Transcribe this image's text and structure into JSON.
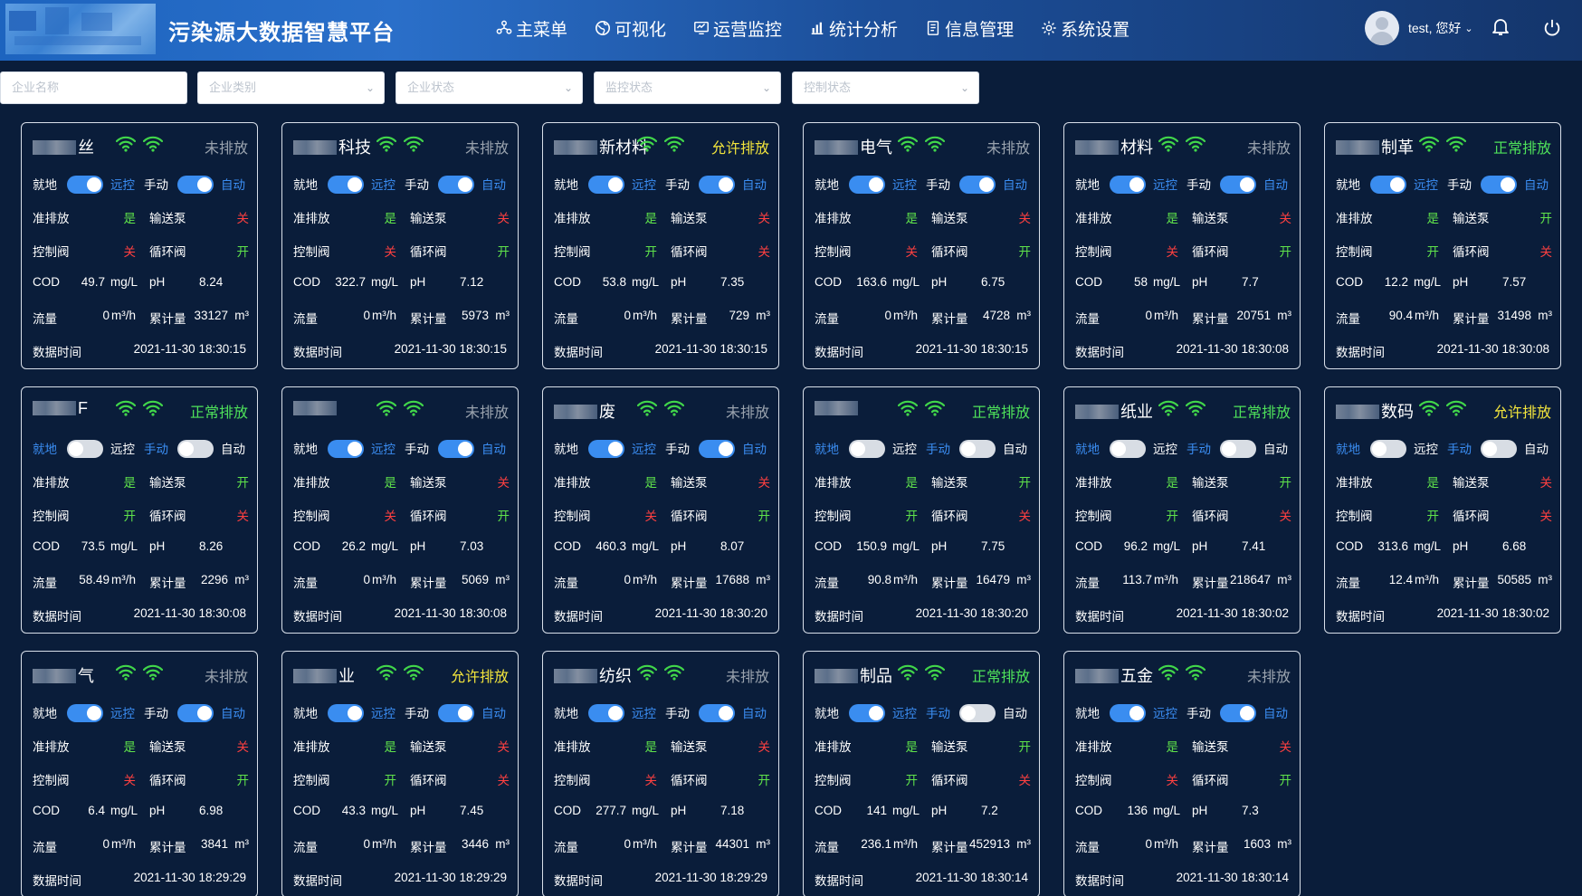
{
  "header": {
    "title": "污染源大数据智慧平台",
    "nav": [
      {
        "label": "主菜单",
        "icon": "menu-icon"
      },
      {
        "label": "可视化",
        "icon": "globe-icon"
      },
      {
        "label": "运营监控",
        "icon": "monitor-icon"
      },
      {
        "label": "统计分析",
        "icon": "bar-chart-icon"
      },
      {
        "label": "信息管理",
        "icon": "document-icon"
      },
      {
        "label": "系统设置",
        "icon": "gear-icon"
      }
    ],
    "user": "test, 您好"
  },
  "filters": {
    "company_name": "企业名称",
    "company_type": "企业类别",
    "company_status": "企业状态",
    "monitor_status": "监控状态",
    "control_status": "控制状态"
  },
  "labels": {
    "local": "就地",
    "remote": "远控",
    "manual": "手动",
    "auto": "自动",
    "permit": "准排放",
    "pump": "输送泵",
    "valve": "控制阀",
    "cycle_valve": "循环阀",
    "cod": "COD",
    "ph": "pH",
    "flow": "流量",
    "total": "累计量",
    "data_time": "数据时间",
    "unit_cod": "mg/L",
    "unit_flow": "m³/h",
    "unit_total": "m³"
  },
  "colors": {
    "on": "#3a8df0",
    "yes": "#5fe24b",
    "no": "#ff4040",
    "normal": "#4ee15a",
    "allowed": "#f2e43c",
    "none": "#9aa3ae"
  },
  "cards": [
    {
      "name": "丝",
      "status": "未排放",
      "status_type": "gray",
      "mode": "remote",
      "ctrl": "auto",
      "permit": "是",
      "pump": "关",
      "valve": "关",
      "cycle": "开",
      "cod": "49.7",
      "ph": "8.24",
      "flow": "0",
      "total": "33127",
      "time": "2021-11-30 18:30:15"
    },
    {
      "name": "科技",
      "status": "未排放",
      "status_type": "gray",
      "mode": "remote",
      "ctrl": "auto",
      "permit": "是",
      "pump": "关",
      "valve": "关",
      "cycle": "开",
      "cod": "322.7",
      "ph": "7.12",
      "flow": "0",
      "total": "5973",
      "time": "2021-11-30 18:30:15"
    },
    {
      "name": "新材料",
      "status": "允许排放",
      "status_type": "yellow",
      "mode": "remote",
      "ctrl": "auto",
      "permit": "是",
      "pump": "关",
      "valve": "开",
      "cycle": "关",
      "cod": "53.8",
      "ph": "7.35",
      "flow": "0",
      "total": "729",
      "time": "2021-11-30 18:30:15"
    },
    {
      "name": "电气",
      "status": "未排放",
      "status_type": "gray",
      "mode": "remote",
      "ctrl": "auto",
      "permit": "是",
      "pump": "关",
      "valve": "关",
      "cycle": "开",
      "cod": "163.6",
      "ph": "6.75",
      "flow": "0",
      "total": "4728",
      "time": "2021-11-30 18:30:15"
    },
    {
      "name": "材料",
      "status": "未排放",
      "status_type": "gray",
      "mode": "remote",
      "ctrl": "auto",
      "permit": "是",
      "pump": "关",
      "valve": "关",
      "cycle": "开",
      "cod": "58",
      "ph": "7.7",
      "flow": "0",
      "total": "20751",
      "time": "2021-11-30 18:30:08"
    },
    {
      "name": "制革",
      "status": "正常排放",
      "status_type": "green",
      "mode": "remote",
      "ctrl": "auto",
      "permit": "是",
      "pump": "开",
      "valve": "开",
      "cycle": "关",
      "cod": "12.2",
      "ph": "7.57",
      "flow": "90.4",
      "total": "31498",
      "time": "2021-11-30 18:30:08"
    },
    {
      "name": "F",
      "status": "正常排放",
      "status_type": "green",
      "mode": "local",
      "ctrl": "manual",
      "permit": "是",
      "pump": "开",
      "valve": "开",
      "cycle": "关",
      "cod": "73.5",
      "ph": "8.26",
      "flow": "58.49",
      "total": "2296",
      "time": "2021-11-30 18:30:08"
    },
    {
      "name": "",
      "status": "未排放",
      "status_type": "gray",
      "mode": "remote",
      "ctrl": "auto",
      "permit": "是",
      "pump": "关",
      "valve": "关",
      "cycle": "开",
      "cod": "26.2",
      "ph": "7.03",
      "flow": "0",
      "total": "5069",
      "time": "2021-11-30 18:30:08"
    },
    {
      "name": "废",
      "status": "未排放",
      "status_type": "gray",
      "mode": "remote",
      "ctrl": "auto",
      "permit": "是",
      "pump": "关",
      "valve": "关",
      "cycle": "开",
      "cod": "460.3",
      "ph": "8.07",
      "flow": "0",
      "total": "17688",
      "time": "2021-11-30 18:30:20"
    },
    {
      "name": "",
      "status": "正常排放",
      "status_type": "green",
      "mode": "local",
      "ctrl": "manual",
      "permit": "是",
      "pump": "开",
      "valve": "开",
      "cycle": "关",
      "cod": "150.9",
      "ph": "7.75",
      "flow": "90.8",
      "total": "16479",
      "time": "2021-11-30 18:30:20"
    },
    {
      "name": "纸业",
      "status": "正常排放",
      "status_type": "green",
      "mode": "local",
      "ctrl": "manual",
      "permit": "是",
      "pump": "开",
      "valve": "开",
      "cycle": "关",
      "cod": "96.2",
      "ph": "7.41",
      "flow": "113.7",
      "total": "218647",
      "time": "2021-11-30 18:30:02"
    },
    {
      "name": "数码",
      "status": "允许排放",
      "status_type": "yellow",
      "mode": "local",
      "ctrl": "manual",
      "permit": "是",
      "pump": "关",
      "valve": "开",
      "cycle": "关",
      "cod": "313.6",
      "ph": "6.68",
      "flow": "12.4",
      "total": "50585",
      "time": "2021-11-30 18:30:02"
    },
    {
      "name": "气",
      "status": "未排放",
      "status_type": "gray",
      "mode": "remote",
      "ctrl": "auto",
      "permit": "是",
      "pump": "关",
      "valve": "关",
      "cycle": "开",
      "cod": "6.4",
      "ph": "6.98",
      "flow": "0",
      "total": "3841",
      "time": "2021-11-30 18:29:29"
    },
    {
      "name": "业",
      "status": "允许排放",
      "status_type": "yellow",
      "mode": "remote",
      "ctrl": "auto",
      "permit": "是",
      "pump": "关",
      "valve": "开",
      "cycle": "关",
      "cod": "43.3",
      "ph": "7.45",
      "flow": "0",
      "total": "3446",
      "time": "2021-11-30 18:29:29"
    },
    {
      "name": "纺织",
      "status": "未排放",
      "status_type": "gray",
      "mode": "remote",
      "ctrl": "auto",
      "permit": "是",
      "pump": "关",
      "valve": "关",
      "cycle": "开",
      "cod": "277.7",
      "ph": "7.18",
      "flow": "0",
      "total": "44301",
      "time": "2021-11-30 18:29:29"
    },
    {
      "name": "制品",
      "status": "正常排放",
      "status_type": "green",
      "mode": "remote",
      "ctrl": "manual",
      "permit": "是",
      "pump": "开",
      "valve": "开",
      "cycle": "关",
      "cod": "141",
      "ph": "7.2",
      "flow": "236.1",
      "total": "452913",
      "time": "2021-11-30 18:30:14"
    },
    {
      "name": "五金",
      "status": "未排放",
      "status_type": "gray",
      "mode": "remote",
      "ctrl": "auto",
      "permit": "是",
      "pump": "关",
      "valve": "关",
      "cycle": "开",
      "cod": "136",
      "ph": "7.3",
      "flow": "0",
      "total": "1603",
      "time": "2021-11-30 18:30:14"
    }
  ]
}
